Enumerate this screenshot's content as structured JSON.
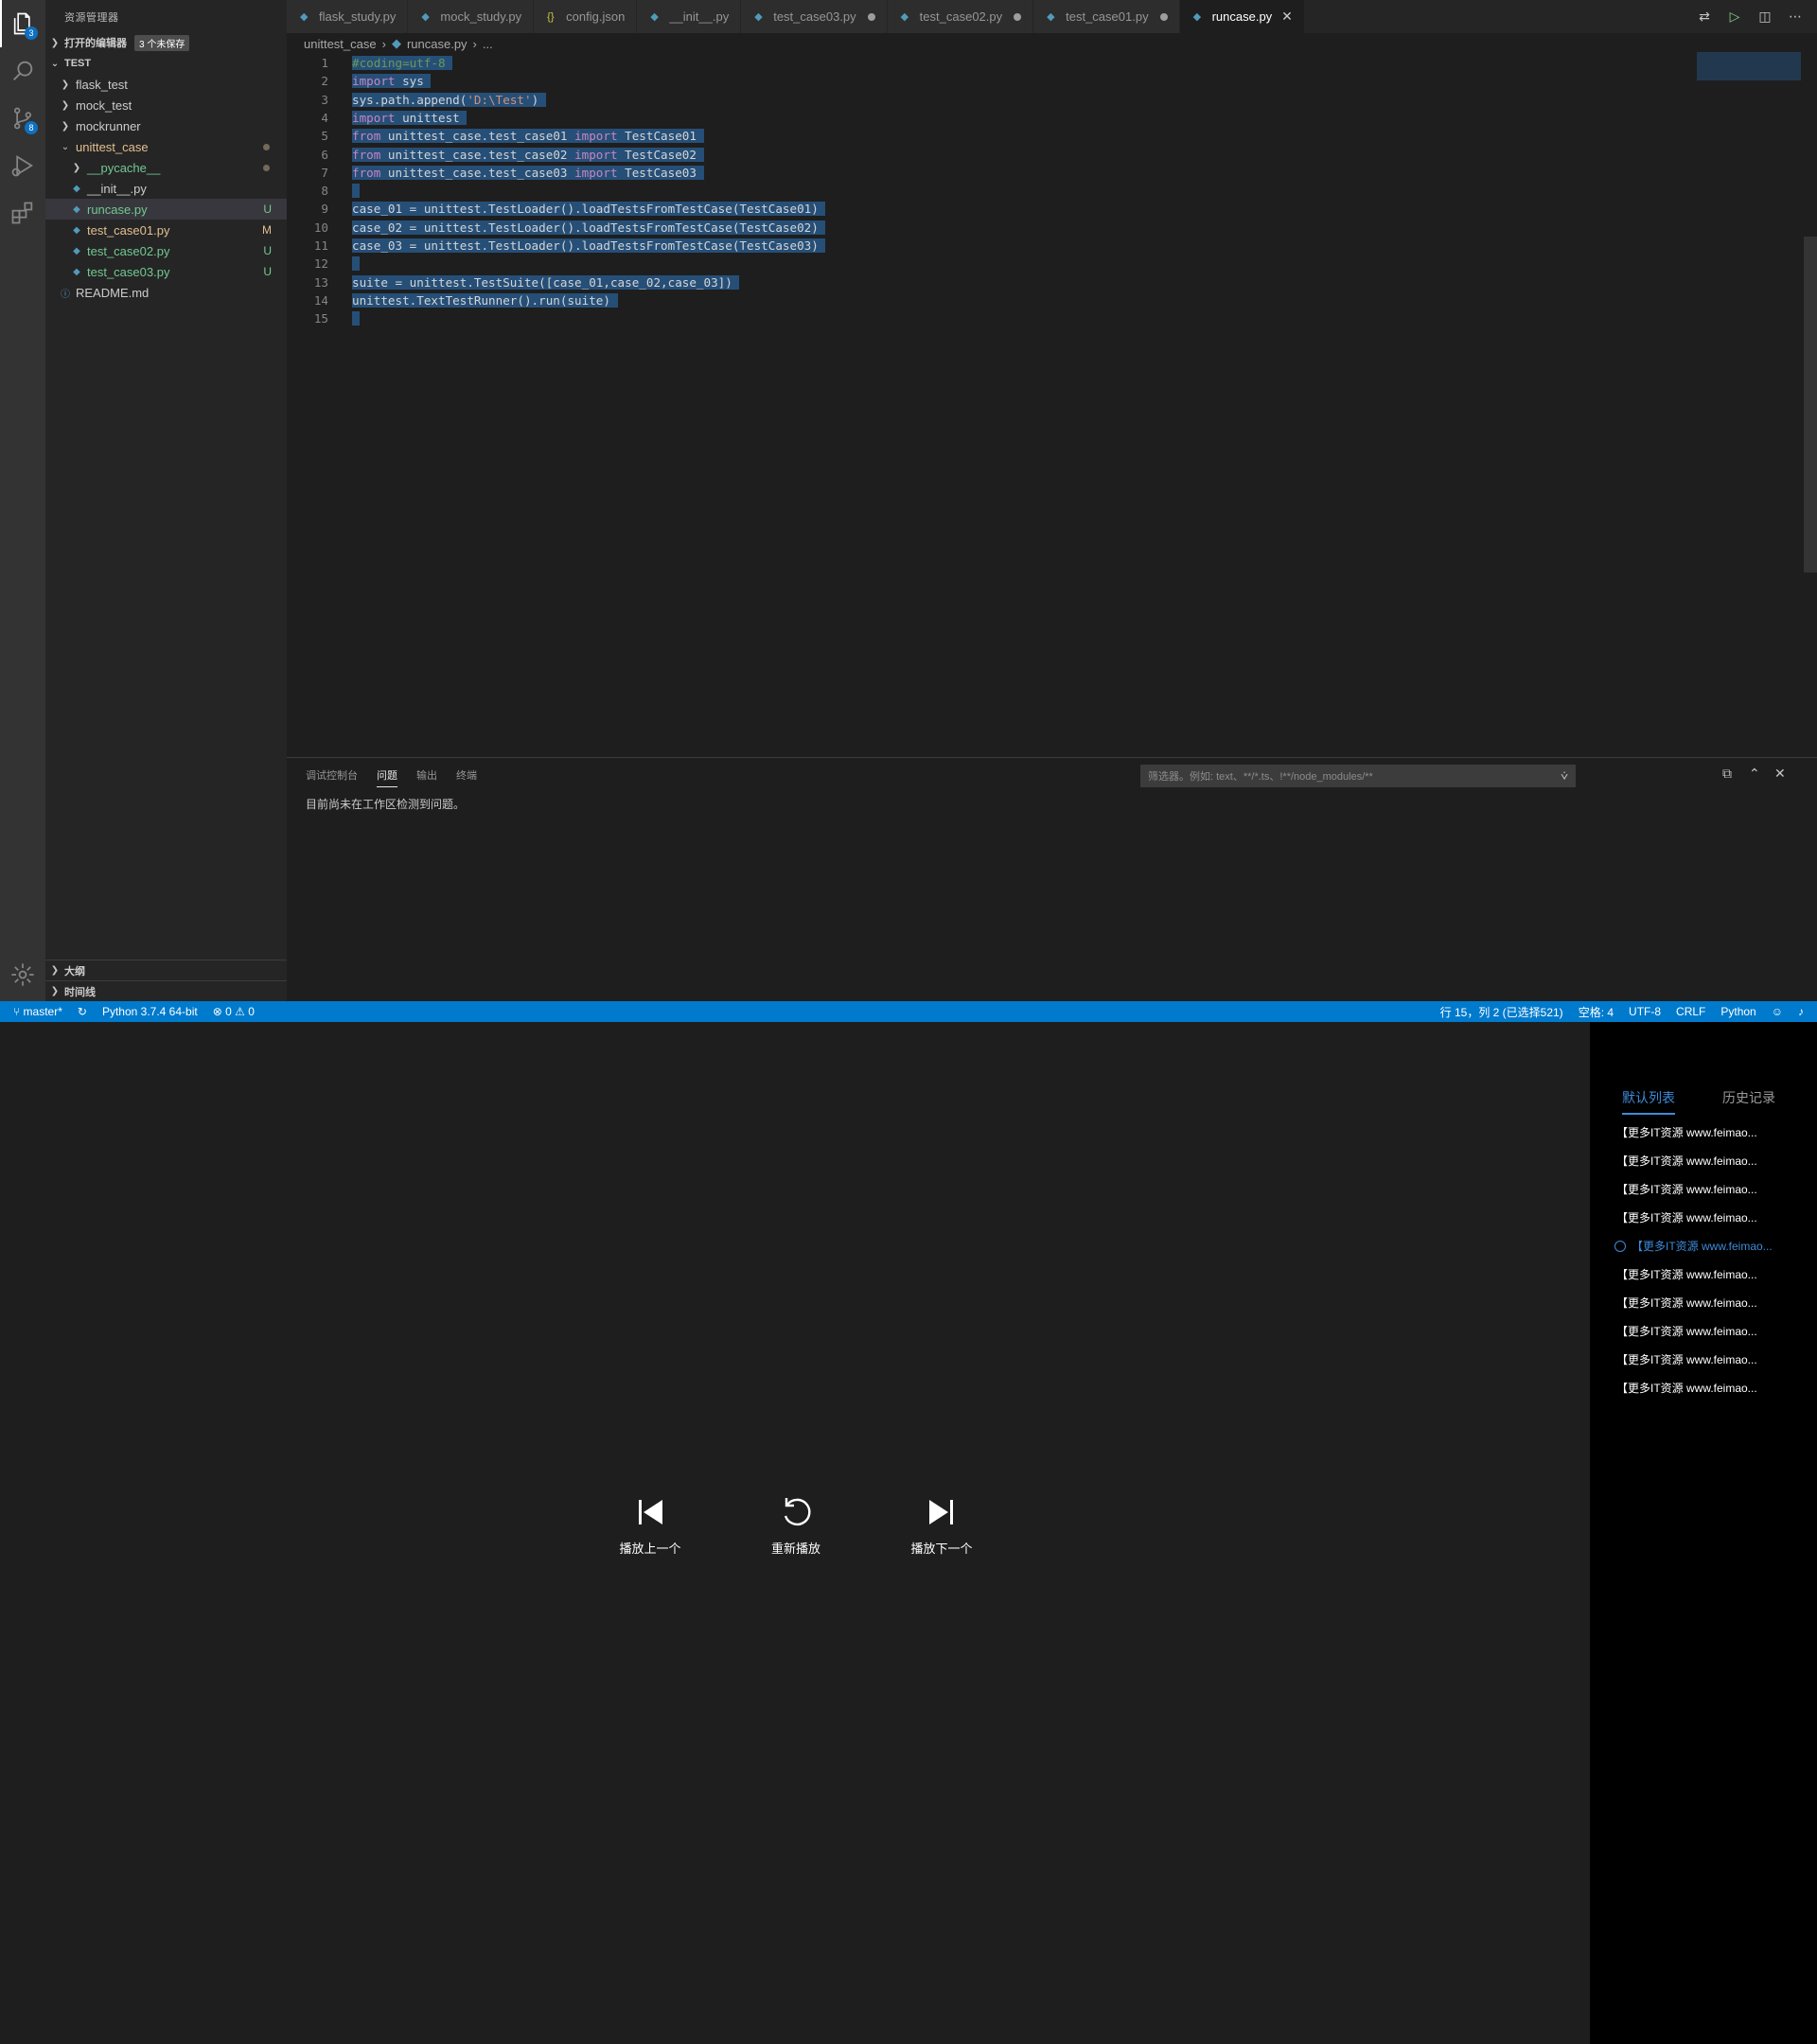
{
  "explorer": {
    "title": "资源管理器",
    "open_editors_label": "打开的编辑器",
    "unsaved_badge": "3 个未保存",
    "workspace_label": "TEST",
    "tree": [
      {
        "label": "flask_test",
        "type": "folder",
        "expanded": false,
        "status": ""
      },
      {
        "label": "mock_test",
        "type": "folder",
        "expanded": false,
        "status": ""
      },
      {
        "label": "mockrunner",
        "type": "folder",
        "expanded": false,
        "status": ""
      },
      {
        "label": "unittest_case",
        "type": "folder",
        "expanded": true,
        "status": "dot"
      },
      {
        "label": "__pycache__",
        "type": "folder",
        "expanded": false,
        "status": "dot"
      },
      {
        "label": "__init__.py",
        "type": "file",
        "status": ""
      },
      {
        "label": "runcase.py",
        "type": "file",
        "status": "U"
      },
      {
        "label": "test_case01.py",
        "type": "file",
        "status": "M"
      },
      {
        "label": "test_case02.py",
        "type": "file",
        "status": "U"
      },
      {
        "label": "test_case03.py",
        "type": "file",
        "status": "U"
      },
      {
        "label": "README.md",
        "type": "info",
        "status": ""
      }
    ],
    "outline_label": "大纲",
    "timeline_label": "时间线"
  },
  "activity_badges": {
    "explorer": "3",
    "scm": "8"
  },
  "tabs": [
    {
      "label": "flask_study.py",
      "dirty": false,
      "active": false,
      "icon": "python-icon"
    },
    {
      "label": "mock_study.py",
      "dirty": false,
      "active": false,
      "icon": "python-icon"
    },
    {
      "label": "config.json",
      "dirty": false,
      "active": false,
      "icon": "json-icon"
    },
    {
      "label": "__init__.py",
      "dirty": false,
      "active": false,
      "icon": "python-icon"
    },
    {
      "label": "test_case03.py",
      "dirty": true,
      "active": false,
      "icon": "python-icon"
    },
    {
      "label": "test_case02.py",
      "dirty": true,
      "active": false,
      "icon": "python-icon"
    },
    {
      "label": "test_case01.py",
      "dirty": true,
      "active": false,
      "icon": "python-icon"
    },
    {
      "label": "runcase.py",
      "dirty": false,
      "active": true,
      "icon": "python-icon"
    }
  ],
  "breadcrumb": {
    "folder": "unittest_case",
    "file": "runcase.py",
    "more": "..."
  },
  "code_lines": [
    {
      "n": "1",
      "t": "#coding=utf-8"
    },
    {
      "n": "2",
      "t": "import sys"
    },
    {
      "n": "3",
      "t": "sys.path.append('D:\\Test')"
    },
    {
      "n": "4",
      "t": "import unittest"
    },
    {
      "n": "5",
      "t": "from unittest_case.test_case01 import TestCase01"
    },
    {
      "n": "6",
      "t": "from unittest_case.test_case02 import TestCase02"
    },
    {
      "n": "7",
      "t": "from unittest_case.test_case03 import TestCase03"
    },
    {
      "n": "8",
      "t": ""
    },
    {
      "n": "9",
      "t": "case_01 = unittest.TestLoader().loadTestsFromTestCase(TestCase01)"
    },
    {
      "n": "10",
      "t": "case_02 = unittest.TestLoader().loadTestsFromTestCase(TestCase02)"
    },
    {
      "n": "11",
      "t": "case_03 = unittest.TestLoader().loadTestsFromTestCase(TestCase03)"
    },
    {
      "n": "12",
      "t": ""
    },
    {
      "n": "13",
      "t": "suite = unittest.TestSuite([case_01,case_02,case_03])"
    },
    {
      "n": "14",
      "t": "unittest.TextTestRunner().run(suite)"
    },
    {
      "n": "15",
      "t": ""
    }
  ],
  "panel": {
    "tabs": [
      "调试控制台",
      "问题",
      "输出",
      "终端"
    ],
    "active_tab": "问题",
    "filter_placeholder": "筛选器。例如: text、**/*.ts、!**/node_modules/**",
    "message": "目前尚未在工作区检测到问题。"
  },
  "statusbar": {
    "branch": "master*",
    "python": "Python 3.7.4 64-bit",
    "errors": "0",
    "warnings": "0",
    "position": "行 15，列 2 (已选择521)",
    "spaces": "空格: 4",
    "encoding": "UTF-8",
    "eol": "CRLF",
    "language": "Python"
  },
  "player": {
    "prev_label": "播放上一个",
    "replay_label": "重新播放",
    "next_label": "播放下一个",
    "playlist_tabs": [
      "默认列表",
      "历史记录"
    ],
    "playlist_items": [
      "【更多IT资源 www.feimao...",
      "【更多IT资源 www.feimao...",
      "【更多IT资源 www.feimao...",
      "【更多IT资源 www.feimao...",
      "【更多IT资源 www.feimao...",
      "【更多IT资源 www.feimao...",
      "【更多IT资源 www.feimao...",
      "【更多IT资源 www.feimao...",
      "【更多IT资源 www.feimao...",
      "【更多IT资源 www.feimao..."
    ],
    "playing_index": 4
  },
  "colors": {
    "statusbar": "#007acc",
    "accent_blue": "#3d8bd9",
    "selection": "#264f78"
  }
}
